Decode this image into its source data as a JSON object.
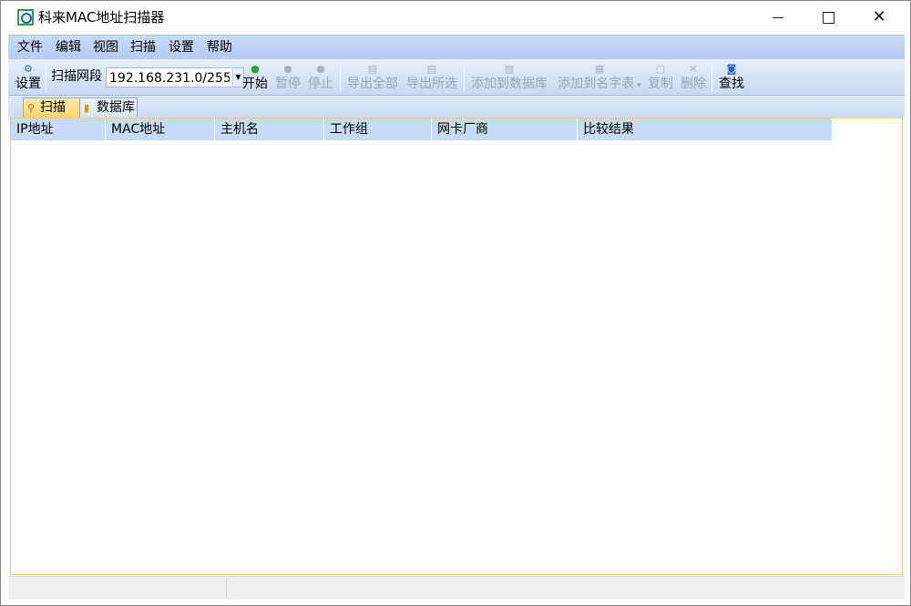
{
  "window": {
    "title": "科来MAC地址扫描器",
    "minimize_icon": "minimize-icon",
    "maximize_icon": "maximize-icon",
    "close_icon": "close-icon",
    "close_glyph": "✕"
  },
  "menu": {
    "items": [
      "文件",
      "编辑",
      "视图",
      "扫描",
      "设置",
      "帮助"
    ]
  },
  "toolbar": {
    "settings_label": "设置",
    "scan_segment_label": "扫描网段",
    "scan_segment_value": "192.168.231.0/255",
    "start_label": "开始",
    "pause_label": "暂停",
    "stop_label": "停止",
    "export_all_label": "导出全部",
    "export_selected_label": "导出所选",
    "add_to_db_label": "添加到数据库",
    "add_to_namelist_label": "添加到名字表",
    "copy_label": "复制",
    "delete_label": "删除",
    "find_label": "查找"
  },
  "tabs": {
    "scan_label": "扫描",
    "database_label": "数据库"
  },
  "grid": {
    "columns": [
      "IP地址",
      "MAC地址",
      "主机名",
      "工作组",
      "网卡厂商",
      "比较结果"
    ],
    "rows": []
  },
  "colors": {
    "menu_bg": "#c8daf5",
    "header_bg": "#c7dbf7",
    "active_tab": "#fcd56f",
    "content_border": "#f0c88c"
  }
}
